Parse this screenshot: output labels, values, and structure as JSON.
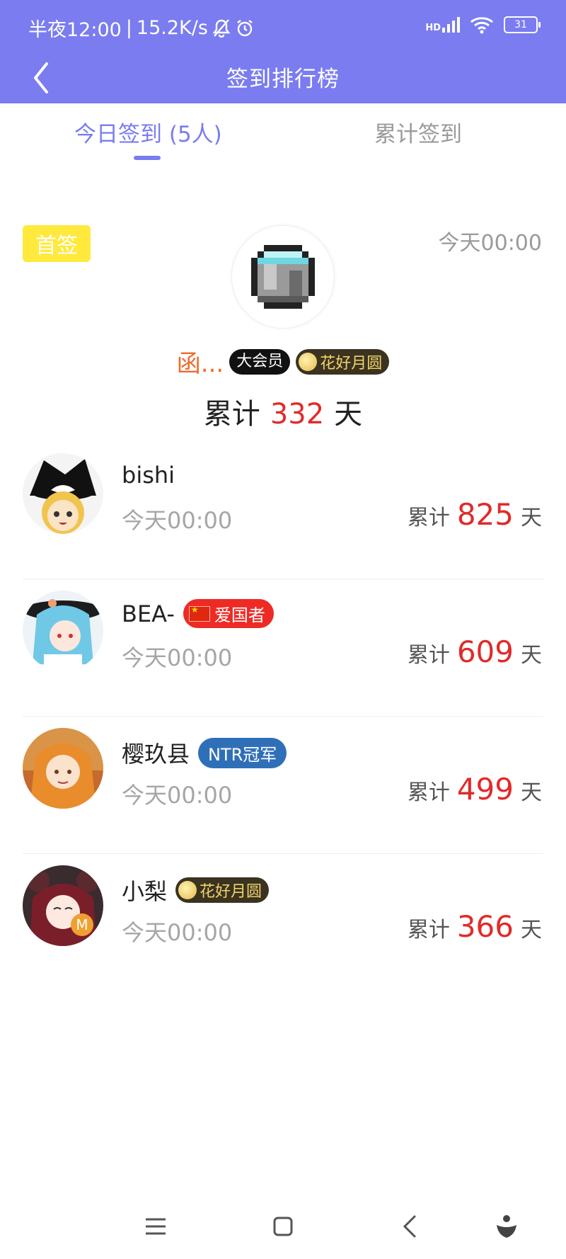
{
  "status": {
    "time": "半夜12:00",
    "speed": "15.2K/s",
    "signal_label": "HD",
    "battery": "31"
  },
  "header": {
    "title": "签到排行榜"
  },
  "tabs": [
    {
      "label": "今日签到 (5人)",
      "active": true
    },
    {
      "label": "累计签到",
      "active": false
    }
  ],
  "first": {
    "badge": "首签",
    "time": "今天00:00",
    "name": "函...",
    "vip_badge": "大会员",
    "medal": "花好月圆",
    "total_prefix": "累计",
    "total_days": "332",
    "total_suffix": "天"
  },
  "rows": [
    {
      "name": "bishi",
      "time": "今天00:00",
      "total_prefix": "累计",
      "days": "825",
      "suffix": "天"
    },
    {
      "name": "BEA-",
      "badge": "爱国者",
      "time": "今天00:00",
      "total_prefix": "累计",
      "days": "609",
      "suffix": "天"
    },
    {
      "name": "樱玖县",
      "badge": "NTR冠军",
      "time": "今天00:00",
      "total_prefix": "累计",
      "days": "499",
      "suffix": "天"
    },
    {
      "name": "小梨",
      "badge": "花好月圆",
      "time": "今天00:00",
      "total_prefix": "累计",
      "days": "366",
      "suffix": "天"
    }
  ],
  "colors": {
    "accent": "#7a7cf0",
    "highlight": "#e12a2a",
    "first_badge": "#ffe93c"
  }
}
